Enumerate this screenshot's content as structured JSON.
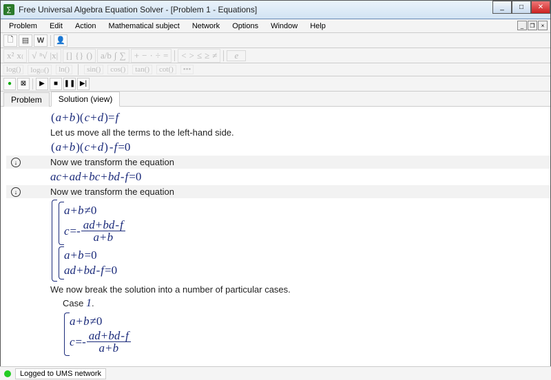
{
  "window": {
    "title": "Free Universal Algebra Equation Solver - [Problem 1 - Equations]"
  },
  "menu": {
    "items": [
      "Problem",
      "Edit",
      "Action",
      "Mathematical subject",
      "Network",
      "Options",
      "Window",
      "Help"
    ]
  },
  "toolbar1_icons": [
    "new-file-icon",
    "open-icon",
    "bold-w-icon",
    "agent-icon"
  ],
  "toolbar_math": {
    "groups_a": [
      "x²",
      "x₍",
      "√",
      "ⁿ√",
      "|x|"
    ],
    "groups_b": [
      "[]",
      "{}",
      "()"
    ],
    "groups_c": [
      "a/b",
      "∫",
      "∑"
    ],
    "ops": [
      "+",
      "−",
      "·",
      "÷",
      "="
    ],
    "rel": [
      "<",
      ">",
      "≤",
      "≥",
      "≠"
    ],
    "var": "e"
  },
  "toolbar_func": [
    "log()",
    "log₍₎()",
    "ln()",
    "sin()",
    "cos()",
    "tan()",
    "cot()",
    "•••"
  ],
  "play_icons": [
    "record-icon",
    "stop-outline-icon",
    "play-icon",
    "stop-icon",
    "pause-icon",
    "step-icon"
  ],
  "tabs": {
    "problem": "Problem",
    "solution": "Solution (view)",
    "active": "solution"
  },
  "solution": {
    "eq1": "(a+b)(c+d)=f",
    "txt1": "Let us move all the terms to the left-hand side.",
    "eq2": "(a+b)(c+d)-f=0",
    "txt2": "Now we transform the equation",
    "eq3": "ac+ad+bc+bd-f=0",
    "txt3": "Now we transform the equation",
    "cases1": {
      "l1": "a+b≠0",
      "l2_lhs": "c=-",
      "l2_num": "ad+bd-f",
      "l2_den": "a+b",
      "l3": "a+b=0",
      "l4": "ad+bd-f=0"
    },
    "txt4": "We now break the solution  into a number of particular cases.",
    "case_label": "Case",
    "case_num": "1",
    "cases2": {
      "l1": "a+b≠0",
      "l2_lhs": "c=-",
      "l2_num": "ad+bd-f",
      "l2_den": "a+b"
    }
  },
  "status": {
    "text": "Logged to UMS network"
  }
}
